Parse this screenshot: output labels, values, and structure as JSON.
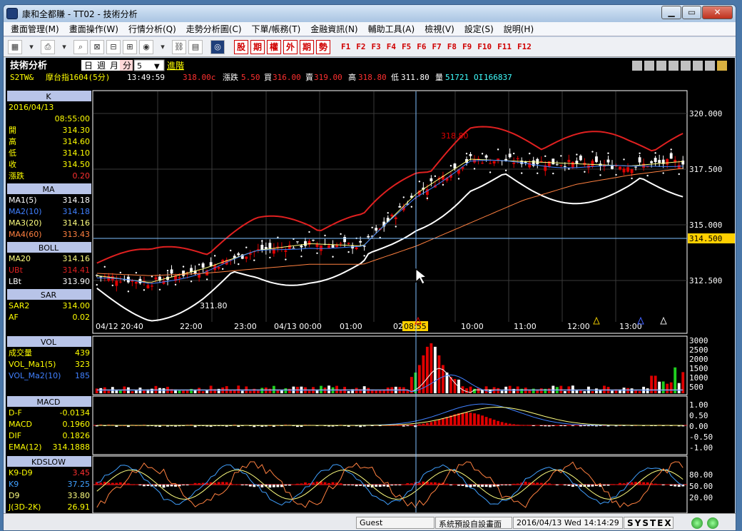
{
  "window": {
    "title": "康和全都賺 - TT02 - 技術分析"
  },
  "menus": [
    "畫面管理(M)",
    "畫面操作(W)",
    "行情分析(Q)",
    "走勢分析圖(C)",
    "下單/帳務(T)",
    "金融資訊(N)",
    "輔助工具(A)",
    "檢視(V)",
    "設定(S)",
    "說明(H)"
  ],
  "toolbar": {
    "red_buttons": [
      "股",
      "期",
      "權",
      "外",
      "期",
      "勢"
    ],
    "fkeys": [
      "F1",
      "F2",
      "F3",
      "F4",
      "F5",
      "F6",
      "F7",
      "F8",
      "F9",
      "F10",
      "F11",
      "F12"
    ]
  },
  "panel": {
    "title": "技術分析",
    "period_tabs": [
      "日",
      "週",
      "月",
      "分"
    ],
    "interval_value": "5",
    "advanced": "進階",
    "symbol": "S2TW&",
    "symbol_name": "摩台指1604(5分)",
    "time": "13:49:59",
    "price": "318.00c",
    "change_label": "漲跌",
    "change": "5.50",
    "bid_label": "買",
    "bid": "316.00",
    "ask_label": "賣",
    "ask": "319.00",
    "high_label": "高",
    "high": "318.80",
    "low_label": "低",
    "low": "311.80",
    "vol_label": "量",
    "vol": "51721",
    "oi_label": "OI",
    "oi": "166837"
  },
  "colors": {
    "candle_up": "#e00000",
    "candle_down": "#ffffff",
    "boll": "#e02020",
    "ma5": "#ffffff",
    "ma10": "#4080ff",
    "ma20": "#ffff80",
    "ma60": "#ff8040",
    "grid": "#3a3a3a",
    "cursor": "#80c0ff",
    "label_bg": "#ffd000"
  },
  "info": {
    "k_title": "K",
    "date": "2016/04/13",
    "time": "08:55:00",
    "ohlc": [
      {
        "label": "開",
        "value": "314.30"
      },
      {
        "label": "高",
        "value": "314.60"
      },
      {
        "label": "低",
        "value": "314.10"
      },
      {
        "label": "收",
        "value": "314.50"
      },
      {
        "label": "漲跌",
        "value": "0.20"
      }
    ],
    "ma_title": "MA",
    "ma": [
      {
        "label": "MA1(5)",
        "value": "314.18",
        "color": "#ffffff"
      },
      {
        "label": "MA2(10)",
        "value": "314.18",
        "color": "#4080ff"
      },
      {
        "label": "MA3(20)",
        "value": "314.16",
        "color": "#ffff80"
      },
      {
        "label": "MA4(60)",
        "value": "313.43",
        "color": "#ff8040"
      }
    ],
    "boll_title": "BOLL",
    "boll": [
      {
        "label": "MA20",
        "value": "314.16",
        "color": "#ffff80"
      },
      {
        "label": "UBt",
        "value": "314.41",
        "color": "#e02020"
      },
      {
        "label": "LBt",
        "value": "313.90",
        "color": "#ffffff"
      }
    ],
    "sar_title": "SAR",
    "sar": [
      {
        "label": "SAR2",
        "value": "314.00"
      },
      {
        "label": "AF",
        "value": "0.02"
      }
    ],
    "vol_title": "VOL",
    "vol": [
      {
        "label": "成交量",
        "value": "439"
      },
      {
        "label": "VOL_Ma1(5)",
        "value": "323"
      },
      {
        "label": "VOL_Ma2(10)",
        "value": "185"
      }
    ],
    "macd_title": "MACD",
    "macd": [
      {
        "label": "D-F",
        "value": "-0.0134"
      },
      {
        "label": "MACD",
        "value": "0.1960"
      },
      {
        "label": "DIF",
        "value": "0.1826"
      },
      {
        "label": "EMA(12)",
        "value": "314.1888"
      }
    ],
    "kd_title": "KDSLOW",
    "kd": [
      {
        "label": "K9-D9",
        "value": "3.45"
      },
      {
        "label": "K9",
        "value": "37.25"
      },
      {
        "label": "D9",
        "value": "33.80"
      },
      {
        "label": "J(3D-2K)",
        "value": "26.91"
      }
    ]
  },
  "chart": {
    "price_ticks": [
      "320.000",
      "317.500",
      "315.000",
      "312.500"
    ],
    "cursor_price": "314.500",
    "cursor_time": "08:55",
    "time_ticks": [
      "04/12 20:40",
      "22:00",
      "23:00",
      "04/13 00:00",
      "01:00",
      "02",
      "09:00",
      "10:00",
      "11:00",
      "12:00",
      "13:00"
    ],
    "high_label": "318.80",
    "low_label": "311.80",
    "vol_ticks": [
      "3000",
      "2500",
      "2000",
      "1500",
      "1000",
      "500"
    ],
    "macd_ticks": [
      "1.00",
      "0.50",
      "0.00",
      "-0.50",
      "-1.00"
    ],
    "kd_ticks": [
      "80.00",
      "50.00",
      "20.00"
    ]
  },
  "chart_data": {
    "type": "line",
    "title": "摩台指1604(5分)",
    "series": [
      {
        "name": "MA1(5)",
        "values": [
          312.9,
          312.6,
          313.2,
          314.0,
          314.3,
          314.2,
          316.5,
          318.0,
          317.9,
          317.8,
          317.7,
          317.9
        ]
      },
      {
        "name": "MA4(60)",
        "values": [
          313.0,
          312.9,
          313.0,
          313.2,
          313.4,
          313.4,
          314.2,
          315.2,
          316.2,
          316.9,
          317.3,
          317.6
        ]
      }
    ],
    "categories": [
      "20:40",
      "22:00",
      "23:00",
      "00:00",
      "01:00",
      "02:00",
      "09:00",
      "10:00",
      "11:00",
      "12:00",
      "13:00",
      "13:50"
    ],
    "ylim": [
      311.0,
      321.0
    ]
  },
  "status": {
    "user": "Guest",
    "layout": "系統預設自設畫面",
    "datetime": "2016/04/13 Wed 14:14:29",
    "brand": "SYSTEX"
  }
}
